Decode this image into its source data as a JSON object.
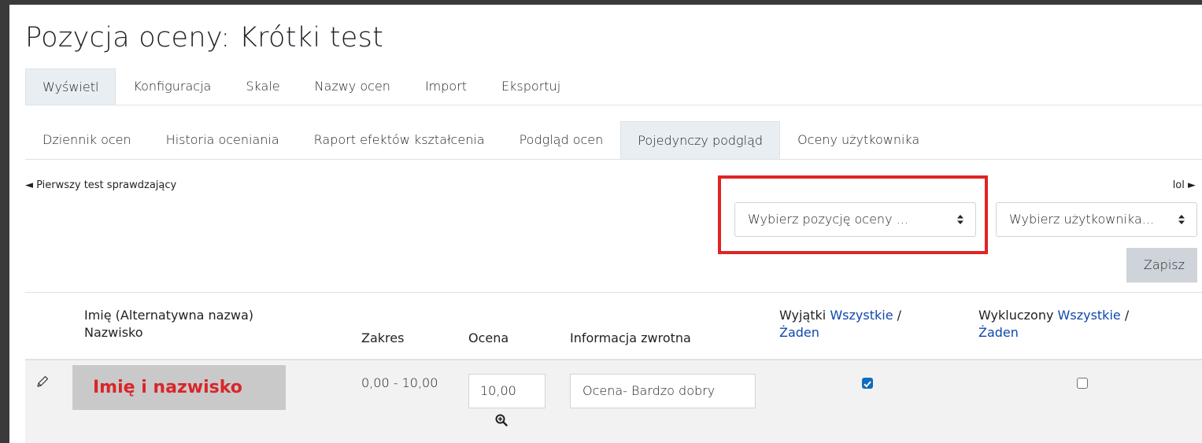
{
  "page": {
    "title": "Pozycja oceny: Krótki test"
  },
  "tabs_primary": [
    {
      "label": "Wyświetl",
      "active": true
    },
    {
      "label": "Konfiguracja",
      "active": false
    },
    {
      "label": "Skale",
      "active": false
    },
    {
      "label": "Nazwy ocen",
      "active": false
    },
    {
      "label": "Import",
      "active": false
    },
    {
      "label": "Eksportuj",
      "active": false
    }
  ],
  "tabs_secondary": [
    {
      "label": "Dziennik ocen",
      "active": false
    },
    {
      "label": "Historia oceniania",
      "active": false
    },
    {
      "label": "Raport efektów kształcenia",
      "active": false
    },
    {
      "label": "Podgląd ocen",
      "active": false
    },
    {
      "label": "Pojedynczy podgląd",
      "active": true
    },
    {
      "label": "Oceny użytkownika",
      "active": false
    }
  ],
  "nav": {
    "prev": "◄ Pierwszy test sprawdzający",
    "next": "lol ►"
  },
  "selects": {
    "grade_item": "Wybierz pozycję oceny ...",
    "user": "Wybierz użytkownika..."
  },
  "save_label": "Zapisz",
  "table": {
    "headers": {
      "name_line1": "Imię (Alternatywna nazwa)",
      "name_line2": "Nazwisko",
      "range": "Zakres",
      "grade": "Ocena",
      "feedback": "Informacja zwrotna",
      "exceptions_label": "Wyjątki",
      "exceptions_all": "Wszystkie",
      "exceptions_sep": "/",
      "exceptions_none": "Żaden",
      "excluded_label": "Wykluczony",
      "excluded_all": "Wszystkie",
      "excluded_sep": "/",
      "excluded_none": "Żaden"
    },
    "rows": [
      {
        "name": "Imię i nazwisko",
        "range": "0,00 - 10,00",
        "grade": "10,00",
        "feedback": "Ocena- Bardzo dobry",
        "exception_checked": true,
        "excluded_checked": false
      }
    ]
  },
  "colors": {
    "accent": "#0f6cbf",
    "link": "#0f47ad",
    "highlight": "#e02424",
    "name_text": "#d9262a"
  }
}
